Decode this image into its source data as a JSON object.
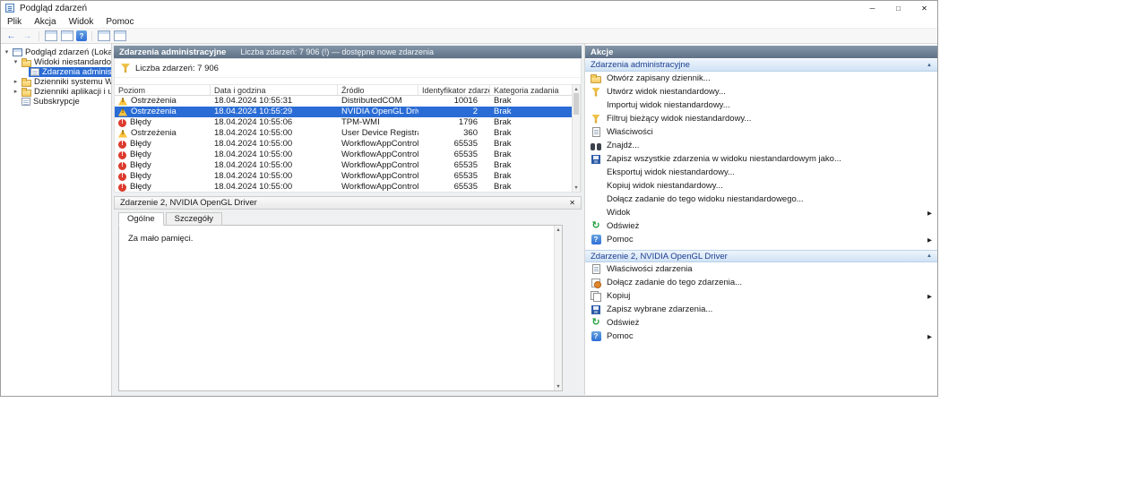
{
  "window": {
    "title": "Podgląd zdarzeń",
    "controls": {
      "minimize": "─",
      "maximize": "□",
      "close": "✕"
    }
  },
  "menubar": {
    "items": [
      "Plik",
      "Akcja",
      "Widok",
      "Pomoc"
    ]
  },
  "toolbar": {
    "icons": [
      {
        "name": "back-icon",
        "style": "back",
        "glyph": "←"
      },
      {
        "name": "forward-icon",
        "style": "forward",
        "glyph": "→"
      },
      {
        "name": "toolbar-separator",
        "style": "sep"
      },
      {
        "name": "show-console-tree-icon",
        "style": "pane"
      },
      {
        "name": "export-list-icon",
        "style": "pane"
      },
      {
        "name": "help-icon",
        "style": "help",
        "glyph": "?"
      },
      {
        "name": "toolbar-separator",
        "style": "sep"
      },
      {
        "name": "show-action-pane-icon",
        "style": "pane"
      },
      {
        "name": "preview-pane-icon",
        "style": "pane"
      }
    ]
  },
  "tree": {
    "items": [
      {
        "label": "Podgląd zdarzeń (Lokalny)",
        "indent": 0,
        "expander": "expanded",
        "icon": "console-root",
        "selected": false
      },
      {
        "label": "Widoki niestandardowe",
        "indent": 1,
        "expander": "expanded",
        "icon": "folder",
        "selected": false
      },
      {
        "label": "Zdarzenia administracyjne",
        "indent": 2,
        "expander": "none",
        "icon": "custom-view",
        "selected": true
      },
      {
        "label": "Dzienniki systemu Windows",
        "indent": 1,
        "expander": "collapsed",
        "icon": "folder",
        "selected": false
      },
      {
        "label": "Dzienniki aplikacji i usług",
        "indent": 1,
        "expander": "collapsed",
        "icon": "folder",
        "selected": false
      },
      {
        "label": "Subskrypcje",
        "indent": 1,
        "expander": "none",
        "icon": "subscriptions",
        "selected": false
      }
    ]
  },
  "list": {
    "header_title": "Zdarzenia administracyjne",
    "header_subtitle": "Liczba zdarzeń: 7 906 (!) — dostępne nowe zdarzenia",
    "filter_label": "Liczba zdarzeń: 7 906",
    "columns": [
      "Poziom",
      "Data i godzina",
      "Źródło",
      "Identyfikator zdarzenia",
      "Kategoria zadania"
    ],
    "rows": [
      {
        "level": "Ostrzeżenia",
        "type": "warning",
        "date": "18.04.2024 10:55:31",
        "source": "DistributedCOM",
        "event_id": "10016",
        "category": "Brak",
        "selected": false
      },
      {
        "level": "Ostrzeżenia",
        "type": "warning",
        "date": "18.04.2024 10:55:29",
        "source": "NVIDIA OpenGL Driver",
        "event_id": "2",
        "category": "Brak",
        "selected": true
      },
      {
        "level": "Błędy",
        "type": "error",
        "date": "18.04.2024 10:55:06",
        "source": "TPM-WMI",
        "event_id": "1796",
        "category": "Brak",
        "selected": false
      },
      {
        "level": "Ostrzeżenia",
        "type": "warning",
        "date": "18.04.2024 10:55:00",
        "source": "User Device Registrati...",
        "event_id": "360",
        "category": "Brak",
        "selected": false
      },
      {
        "level": "Błędy",
        "type": "error",
        "date": "18.04.2024 10:55:00",
        "source": "WorkflowAppControl",
        "event_id": "65535",
        "category": "Brak",
        "selected": false
      },
      {
        "level": "Błędy",
        "type": "error",
        "date": "18.04.2024 10:55:00",
        "source": "WorkflowAppControl",
        "event_id": "65535",
        "category": "Brak",
        "selected": false
      },
      {
        "level": "Błędy",
        "type": "error",
        "date": "18.04.2024 10:55:00",
        "source": "WorkflowAppControl",
        "event_id": "65535",
        "category": "Brak",
        "selected": false
      },
      {
        "level": "Błędy",
        "type": "error",
        "date": "18.04.2024 10:55:00",
        "source": "WorkflowAppControl",
        "event_id": "65535",
        "category": "Brak",
        "selected": false
      },
      {
        "level": "Błędy",
        "type": "error",
        "date": "18.04.2024 10:55:00",
        "source": "WorkflowAppControl",
        "event_id": "65535",
        "category": "Brak",
        "selected": false
      }
    ]
  },
  "detail": {
    "title": "Zdarzenie 2, NVIDIA OpenGL Driver",
    "close_glyph": "✕",
    "tabs": [
      {
        "label": "Ogólne",
        "active": true
      },
      {
        "label": "Szczegóły",
        "active": false
      }
    ],
    "content": "Za mało pamięci."
  },
  "actions": {
    "title": "Akcje",
    "sections": [
      {
        "header": "Zdarzenia administracyjne",
        "items": [
          {
            "label": "Otwórz zapisany dziennik...",
            "icon": "open-log",
            "submenu": false
          },
          {
            "label": "Utwórz widok niestandardowy...",
            "icon": "create-view",
            "submenu": false
          },
          {
            "label": "Importuj widok niestandardowy...",
            "icon": null,
            "submenu": false
          },
          {
            "label": "Filtruj bieżący widok niestandardowy...",
            "icon": "filter",
            "submenu": false
          },
          {
            "label": "Właściwości",
            "icon": "properties",
            "submenu": false
          },
          {
            "label": "Znajdź...",
            "icon": "find",
            "submenu": false
          },
          {
            "label": "Zapisz wszystkie zdarzenia w widoku niestandardowym jako...",
            "icon": "save",
            "submenu": false
          },
          {
            "label": "Eksportuj widok niestandardowy...",
            "icon": null,
            "submenu": false
          },
          {
            "label": "Kopiuj widok niestandardowy...",
            "icon": null,
            "submenu": false
          },
          {
            "label": "Dołącz zadanie do tego widoku niestandardowego...",
            "icon": null,
            "submenu": false
          },
          {
            "label": "Widok",
            "icon": null,
            "submenu": true
          },
          {
            "label": "Odśwież",
            "icon": "refresh",
            "submenu": false
          },
          {
            "label": "Pomoc",
            "icon": "help",
            "submenu": true
          }
        ]
      },
      {
        "header": "Zdarzenie 2, NVIDIA OpenGL Driver",
        "items": [
          {
            "label": "Właściwości zdarzenia",
            "icon": "properties",
            "submenu": false
          },
          {
            "label": "Dołącz zadanie do tego zdarzenia...",
            "icon": "attach-task",
            "submenu": false
          },
          {
            "label": "Kopiuj",
            "icon": "copy",
            "submenu": true
          },
          {
            "label": "Zapisz wybrane zdarzenia...",
            "icon": "save",
            "submenu": false
          },
          {
            "label": "Odśwież",
            "icon": "refresh",
            "submenu": false
          },
          {
            "label": "Pomoc",
            "icon": "help",
            "submenu": true
          }
        ]
      }
    ]
  },
  "colors": {
    "selection_blue": "#2a6cd5",
    "pane_header_top": "#8496a8",
    "pane_header_bottom": "#5f7186",
    "section_header_blue": "#cfe2f5",
    "warning_yellow": "#fcc43e",
    "error_red": "#dd3a2e"
  }
}
